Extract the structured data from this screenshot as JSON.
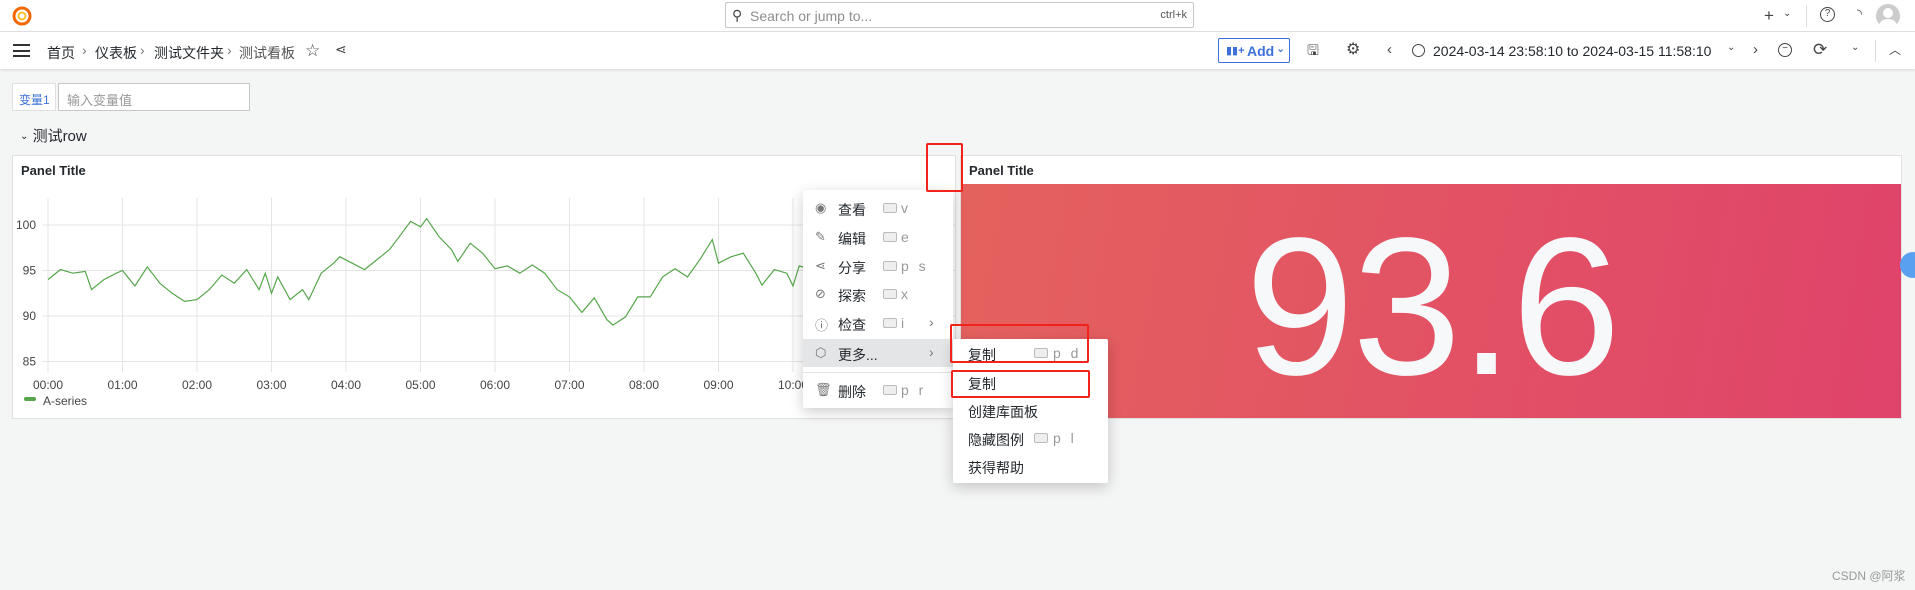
{
  "topbar": {
    "search_placeholder": "Search or jump to...",
    "search_shortcut": "ctrl+k",
    "icons": [
      "grafana-logo-icon",
      "search-icon",
      "keyboard-icon",
      "plus-icon",
      "chevron-down-icon",
      "help-icon",
      "rss-icon",
      "avatar"
    ]
  },
  "navbar": {
    "breadcrumbs": [
      "首页",
      "仪表板",
      "测试文件夹",
      "测试看板"
    ],
    "add_label": "Add",
    "time_range": "2024-03-14 23:58:10 to 2024-03-15 11:58:10"
  },
  "variables": {
    "label": "变量1",
    "placeholder": "输入变量值"
  },
  "row": {
    "title": "测试row"
  },
  "panels": [
    {
      "title": "Panel Title"
    },
    {
      "title": "Panel Title",
      "value": "93.6",
      "background_start": "#e4625e",
      "background_end": "#e0436a"
    }
  ],
  "chart_data": {
    "type": "line",
    "title": "Panel Title",
    "x_tick_labels": [
      "00:00",
      "01:00",
      "02:00",
      "03:00",
      "04:00",
      "05:00",
      "06:00",
      "07:00",
      "08:00",
      "09:00",
      "10:00"
    ],
    "y_tick_labels": [
      "85",
      "90",
      "95",
      "100"
    ],
    "ylim": [
      83.5,
      102.5
    ],
    "grid": true,
    "legend": "bottom-left",
    "series": [
      {
        "name": "A-series",
        "color": "#56a64b",
        "x": [
          "00:00",
          "00:10",
          "00:20",
          "00:30",
          "00:35",
          "00:45",
          "00:55",
          "01:00",
          "01:10",
          "01:20",
          "01:30",
          "01:40",
          "01:50",
          "02:00",
          "02:10",
          "02:20",
          "02:30",
          "02:40",
          "02:50",
          "02:55",
          "03:00",
          "03:05",
          "03:15",
          "03:25",
          "03:30",
          "03:40",
          "03:50",
          "03:55",
          "04:05",
          "04:15",
          "04:25",
          "04:35",
          "04:45",
          "04:52",
          "05:00",
          "05:05",
          "05:15",
          "05:25",
          "05:30",
          "05:40",
          "05:50",
          "06:00",
          "06:10",
          "06:20",
          "06:30",
          "06:40",
          "06:50",
          "07:00",
          "07:10",
          "07:20",
          "07:30",
          "07:35",
          "07:45",
          "07:55",
          "08:05",
          "08:15",
          "08:25",
          "08:35",
          "08:45",
          "08:55",
          "09:00",
          "09:10",
          "09:20",
          "09:30",
          "09:35",
          "09:45",
          "09:55",
          "10:00",
          "10:05",
          "10:10"
        ],
        "y": [
          94.0,
          95.1,
          94.7,
          94.9,
          92.9,
          94.0,
          94.7,
          95.0,
          93.3,
          95.4,
          93.6,
          92.5,
          91.6,
          91.8,
          92.9,
          94.5,
          93.6,
          95.1,
          92.9,
          94.7,
          92.5,
          94.3,
          91.8,
          92.9,
          91.8,
          94.7,
          95.8,
          96.5,
          95.8,
          95.1,
          96.2,
          97.3,
          99.1,
          100.4,
          99.8,
          100.7,
          98.7,
          97.3,
          96.0,
          98.0,
          96.9,
          95.2,
          95.5,
          94.7,
          95.6,
          94.7,
          92.9,
          92.1,
          90.4,
          92.0,
          89.6,
          89.0,
          89.9,
          92.1,
          92.1,
          94.3,
          95.2,
          94.3,
          96.2,
          98.4,
          95.8,
          96.5,
          96.9,
          94.7,
          93.4,
          95.1,
          94.7,
          93.3,
          95.5,
          95.3
        ]
      }
    ]
  },
  "context_menu": {
    "items": [
      {
        "label": "查看",
        "icon": "eye-icon",
        "key": "v"
      },
      {
        "label": "编辑",
        "icon": "edit-icon",
        "key": "e"
      },
      {
        "label": "分享",
        "icon": "share-icon",
        "key": "p s"
      },
      {
        "label": "探索",
        "icon": "compass-icon",
        "key": "x"
      },
      {
        "label": "检查",
        "icon": "info-icon",
        "key": "i"
      },
      {
        "label": "更多...",
        "icon": "cube-icon"
      },
      {
        "label": "删除",
        "icon": "trash-icon",
        "key": "p r"
      }
    ]
  },
  "submenu": {
    "items": [
      {
        "label": "复制",
        "key": "p d"
      },
      {
        "label": "复制"
      },
      {
        "label": "创建库面板"
      },
      {
        "label": "隐藏图例",
        "key": "p l"
      },
      {
        "label": "获得帮助"
      }
    ]
  },
  "watermark": "CSDN @阿浆"
}
